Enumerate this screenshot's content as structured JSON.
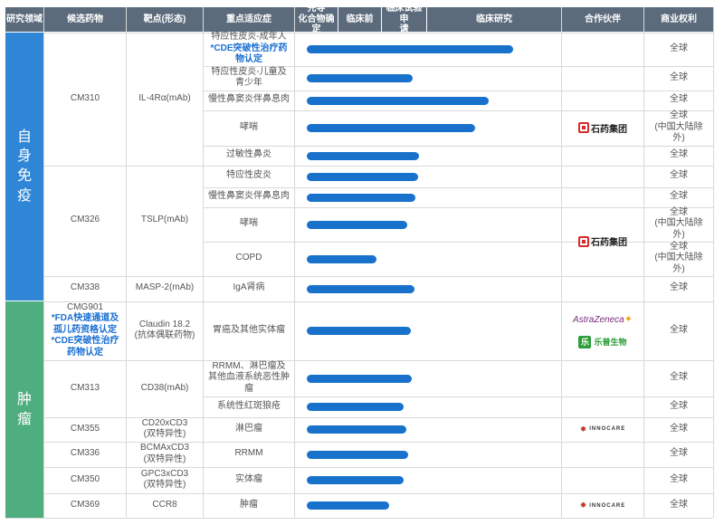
{
  "headers": {
    "area": "研究领域",
    "candidate": "候选药物",
    "target": "靶点(形态)",
    "indication": "重点适应症",
    "lead": "先导\n化合物确定",
    "preclinical": "临床前",
    "ind": "临床试验申\n请",
    "clinical": "临床研究",
    "partner": "合作伙伴",
    "rights": "商业权利"
  },
  "areas": [
    {
      "label": "自\n身\n免\n疫",
      "color": "#2f86d6"
    },
    {
      "label": "肿\n瘤",
      "color": "#4fae7f"
    }
  ],
  "drugs": [
    {
      "name": "CM310",
      "target": "IL-4Rα(mAb)"
    },
    {
      "name": "CM326",
      "target": "TSLP(mAb)"
    },
    {
      "name": "CM338",
      "target": "MASP-2(mAb)"
    },
    {
      "name": "CMG901",
      "note": "*FDA快速通道及\n孤儿药资格认定\n*CDE突破性治疗\n药物认定",
      "target": "Claudin 18.2\n(抗体偶联药物)"
    },
    {
      "name": "CM313",
      "target": "CD38(mAb)"
    },
    {
      "name": "CM355",
      "target": "CD20xCD3\n(双特异性)"
    },
    {
      "name": "CM336",
      "target": "BCMAxCD3\n(双特异性)"
    },
    {
      "name": "CM350",
      "target": "GPC3xCD3\n(双特异性)"
    },
    {
      "name": "CM369",
      "target": "CCR8"
    }
  ],
  "indications": [
    {
      "text": "特应性皮炎-成年人",
      "note": "*CDE突破性治疗药\n物认定",
      "rights": "全球"
    },
    {
      "text": "特应性皮炎-儿童及\n青少年",
      "rights": "全球"
    },
    {
      "text": "慢性鼻窦炎伴鼻息肉",
      "rights": "全球"
    },
    {
      "text": "哮喘",
      "rights": "全球\n(中国大陆除\n外)"
    },
    {
      "text": "过敏性鼻炎",
      "rights": "全球"
    },
    {
      "text": "特应性皮炎",
      "rights": "全球"
    },
    {
      "text": "慢性鼻窦炎伴鼻息肉",
      "rights": "全球"
    },
    {
      "text": "哮喘",
      "rights": "全球\n(中国大陆除\n外)"
    },
    {
      "text": "COPD",
      "rights": "全球\n(中国大陆除\n外)"
    },
    {
      "text": "IgA肾病",
      "rights": "全球"
    },
    {
      "text": "胃癌及其他实体瘤",
      "rights": "全球"
    },
    {
      "text": "RRMM、淋巴瘤及\n其他血液系统恶性肿\n瘤",
      "rights": "全球"
    },
    {
      "text": "系统性红斑狼疮",
      "rights": "全球"
    },
    {
      "text": "淋巴瘤",
      "rights": "全球"
    },
    {
      "text": "RRMM",
      "rights": "全球"
    },
    {
      "text": "实体瘤",
      "rights": "全球"
    },
    {
      "text": "肿瘤",
      "rights": "全球"
    }
  ],
  "partners": {
    "cspc": "石药集团",
    "astrazeneca": "AstraZeneca",
    "keymed_lk": "乐普生物",
    "innocare": "INNOCARE"
  },
  "chart_data": {
    "type": "bar",
    "orientation": "horizontal",
    "stages": [
      "先导化合物确定",
      "临床前",
      "临床试验申请",
      "临床研究"
    ],
    "note": "progress is the bar end measured in stage units: 0 = start of 先导化合物确定, 4 = end of 临床研究",
    "categories": [
      "CM310 特应性皮炎-成年人",
      "CM310 特应性皮炎-儿童及青少年",
      "CM310 慢性鼻窦炎伴鼻息肉",
      "CM310 哮喘",
      "CM310 过敏性鼻炎",
      "CM326 特应性皮炎",
      "CM326 慢性鼻窦炎伴鼻息肉",
      "CM326 哮喘",
      "CM326 COPD",
      "CM338 IgA肾病",
      "CMG901 胃癌及其他实体瘤",
      "CM313 RRMM、淋巴瘤及其他血液系统恶性肿瘤",
      "CM313 系统性红斑狼疮",
      "CM355 淋巴瘤",
      "CM336 RRMM",
      "CM350 实体瘤",
      "CM369 肿瘤"
    ],
    "values": [
      3.64,
      2.68,
      3.46,
      3.36,
      2.81,
      2.79,
      2.74,
      2.56,
      1.87,
      2.71,
      2.64,
      2.65,
      2.47,
      2.53,
      2.57,
      2.47,
      2.16
    ]
  }
}
